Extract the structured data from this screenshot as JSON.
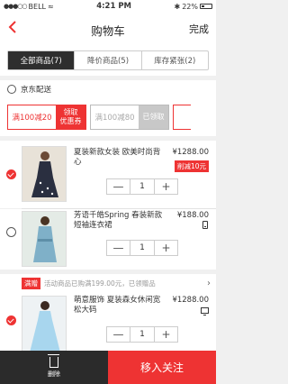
{
  "status_bar": {
    "carrier": "BELL",
    "time": "4:21 PM",
    "battery": "22%"
  },
  "nav": {
    "back_icon": "chevron-left-icon",
    "title": "购物车",
    "done_label": "完成"
  },
  "tabs": [
    {
      "label": "全部商品(7)",
      "active": true
    },
    {
      "label": "降价商品(5)",
      "active": false
    },
    {
      "label": "库存紧张(2)",
      "active": false
    }
  ],
  "section": {
    "title": "京东配送"
  },
  "coupons": [
    {
      "value": "满100减20",
      "action_line1": "领取",
      "action_line2": "优惠券",
      "state": "available"
    },
    {
      "value": "满100减80",
      "action_line1": "已领取",
      "action_line2": "",
      "state": "claimed"
    }
  ],
  "items": [
    {
      "name": "夏装新款女装 欧美时尚背心",
      "price": "¥1288.00",
      "tag": "削减10元",
      "quantity": "1",
      "checked": true,
      "device_icon": ""
    },
    {
      "name": "芳语千皓Spring 春装新款短袖连衣裙",
      "price": "¥188.00",
      "tag": "",
      "quantity": "1",
      "checked": false,
      "device_icon": "phone-icon"
    },
    {
      "name": "萌意服饰 夏装森女休闲宽松大码",
      "price": "¥1288.00",
      "tag": "",
      "quantity": "1",
      "checked": true,
      "device_icon": "monitor-icon"
    }
  ],
  "promo": {
    "tag": "满赠",
    "text": "活动商品已购满199.00元，已领赠品"
  },
  "stepper": {
    "minus": "—",
    "plus": "+"
  },
  "bottom": {
    "delete_label": "删除",
    "follow_label": "移入关注"
  },
  "colors": {
    "accent": "#ee3333",
    "dark": "#2b2b2b"
  }
}
